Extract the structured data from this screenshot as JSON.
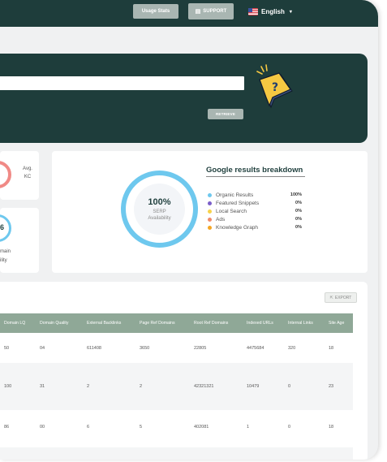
{
  "topbar": {
    "usage_label": "Usage Stats",
    "support_label": "SUPPORT",
    "language": "English"
  },
  "hero": {
    "retrieve_label": "RETRIEVE"
  },
  "kc_card": {
    "label_line1": "Avg.",
    "label_line2": "KC",
    "ring_color": "#f08a86"
  },
  "da_card": {
    "value_fragment": "6",
    "sub_line1": "main",
    "sub_line2": "ility",
    "ring_color": "#6ec8ee"
  },
  "google": {
    "title": "Google results breakdown",
    "serp_percent": "100%",
    "serp_label1": "SERP",
    "serp_label2": "Availability",
    "legend": [
      {
        "label": "Organic Results",
        "value": "100%",
        "color": "#6ec8ee"
      },
      {
        "label": "Featured Snippets",
        "value": "0%",
        "color": "#7b5fc9"
      },
      {
        "label": "Local Search",
        "value": "0%",
        "color": "#f7d24a"
      },
      {
        "label": "Ads",
        "value": "0%",
        "color": "#f08a6a"
      },
      {
        "label": "Knowledge Graph",
        "value": "0%",
        "color": "#f5a623"
      }
    ]
  },
  "table": {
    "export_label": "EXPORT",
    "columns": [
      "Domain LQ",
      "Domain Quality",
      "External Backlinks",
      "Page Ref Domains",
      "Root Ref Domains",
      "Indexed URLs",
      "Internal Links",
      "Site Age"
    ],
    "rows": [
      [
        "50",
        "04",
        "611408",
        "3650",
        "22805",
        "4475684",
        "320",
        "18"
      ],
      [
        "100",
        "31",
        "2",
        "2",
        "42321321",
        "10479",
        "0",
        "23"
      ],
      [
        "86",
        "00",
        "6",
        "5",
        "402081",
        "1",
        "0",
        "18"
      ]
    ]
  },
  "colors": {
    "brand_dark": "#1e3d3b",
    "button_gray": "#a9b6b2",
    "table_header": "#8fa897"
  }
}
